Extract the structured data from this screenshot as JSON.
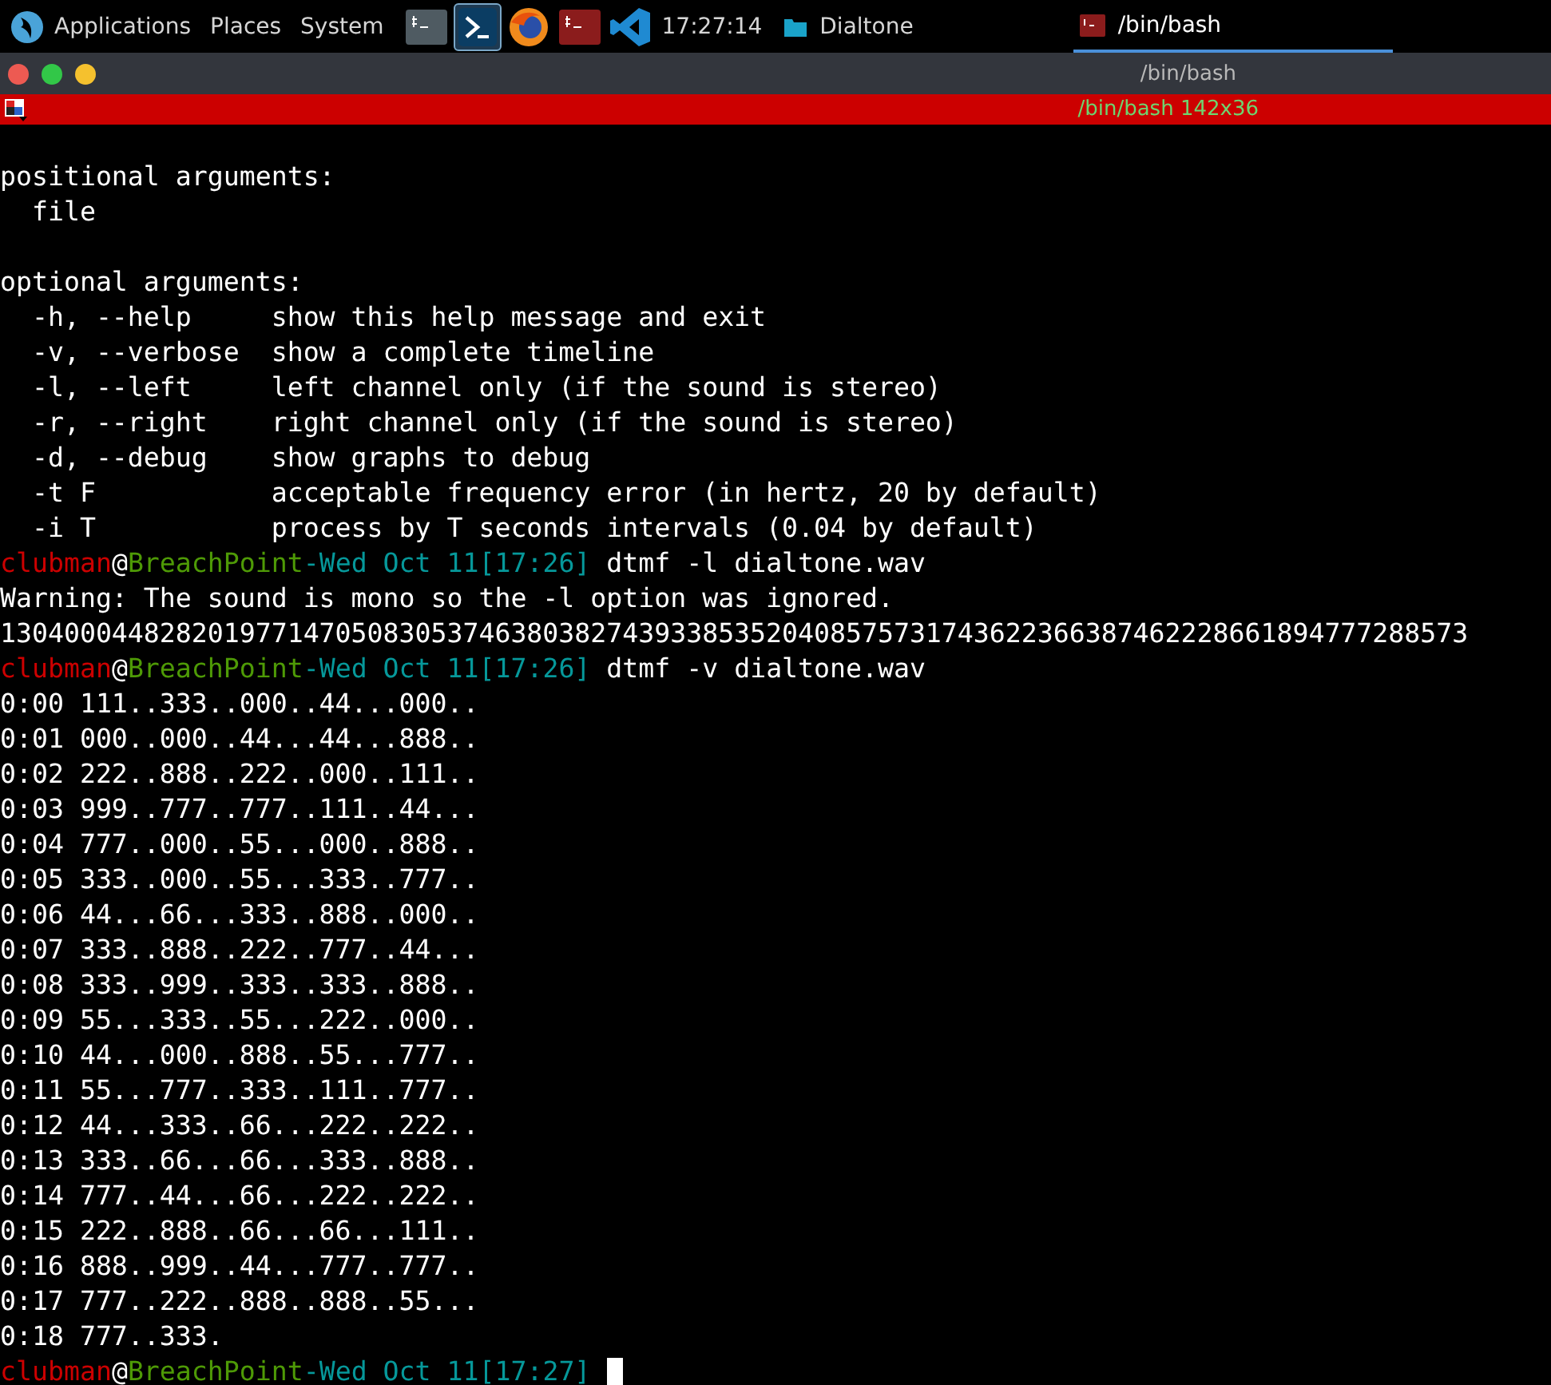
{
  "top_bar": {
    "menus": [
      "Applications",
      "Places",
      "System"
    ],
    "launchers": [
      {
        "kind": "terminal",
        "selected": false
      },
      {
        "kind": "shell",
        "selected": true
      },
      {
        "kind": "browser",
        "selected": false
      },
      {
        "kind": "terminal-red",
        "selected": false
      },
      {
        "kind": "editor",
        "selected": false
      }
    ],
    "clock": "17:27:14",
    "places": [
      {
        "label": "Dialtone"
      }
    ],
    "tasks": [
      {
        "label": "/bin/bash",
        "selected": true
      }
    ]
  },
  "window": {
    "title": "/bin/bash",
    "tab": "/bin/bash 142x36"
  },
  "terminal": {
    "lines": [
      {
        "kind": "blank"
      },
      {
        "kind": "text",
        "text": "positional arguments:"
      },
      {
        "kind": "text",
        "text": "  file"
      },
      {
        "kind": "blank"
      },
      {
        "kind": "text",
        "text": "optional arguments:"
      },
      {
        "kind": "text",
        "text": "  -h, --help     show this help message and exit"
      },
      {
        "kind": "text",
        "text": "  -v, --verbose  show a complete timeline"
      },
      {
        "kind": "text",
        "text": "  -l, --left     left channel only (if the sound is stereo)"
      },
      {
        "kind": "text",
        "text": "  -r, --right    right channel only (if the sound is stereo)"
      },
      {
        "kind": "text",
        "text": "  -d, --debug    show graphs to debug"
      },
      {
        "kind": "text",
        "text": "  -t F           acceptable frequency error (in hertz, 20 by default)"
      },
      {
        "kind": "text",
        "text": "  -i T           process by T seconds intervals (0.04 by default)"
      },
      {
        "kind": "prompt",
        "segments": [
          {
            "text": "clubman",
            "color": "#cc0000"
          },
          {
            "text": "@",
            "color": "#ffffff"
          },
          {
            "text": "BreachPoint",
            "color": "#4e9a06"
          },
          {
            "text": "-Wed Oct 11[17:26]",
            "color": "#06989a"
          },
          {
            "text": " dtmf -l dialtone.wav",
            "color": "#ffffff"
          }
        ]
      },
      {
        "kind": "text",
        "text": "Warning: The sound is mono so the -l option was ignored."
      },
      {
        "kind": "text",
        "text": "13040004482820197714705083053746380382743933853520408575731743622366387462228661894777288573"
      },
      {
        "kind": "prompt",
        "segments": [
          {
            "text": "clubman",
            "color": "#cc0000"
          },
          {
            "text": "@",
            "color": "#ffffff"
          },
          {
            "text": "BreachPoint",
            "color": "#4e9a06"
          },
          {
            "text": "-Wed Oct 11[17:26]",
            "color": "#06989a"
          },
          {
            "text": " dtmf -v dialtone.wav",
            "color": "#ffffff"
          }
        ]
      },
      {
        "kind": "text",
        "text": "0:00 111..333..000..44...000.."
      },
      {
        "kind": "text",
        "text": "0:01 000..000..44...44...888.."
      },
      {
        "kind": "text",
        "text": "0:02 222..888..222..000..111.."
      },
      {
        "kind": "text",
        "text": "0:03 999..777..777..111..44..."
      },
      {
        "kind": "text",
        "text": "0:04 777..000..55...000..888.."
      },
      {
        "kind": "text",
        "text": "0:05 333..000..55...333..777.."
      },
      {
        "kind": "text",
        "text": "0:06 44...66...333..888..000.."
      },
      {
        "kind": "text",
        "text": "0:07 333..888..222..777..44..."
      },
      {
        "kind": "text",
        "text": "0:08 333..999..333..333..888.."
      },
      {
        "kind": "text",
        "text": "0:09 55...333..55...222..000.."
      },
      {
        "kind": "text",
        "text": "0:10 44...000..888..55...777.."
      },
      {
        "kind": "text",
        "text": "0:11 55...777..333..111..777.."
      },
      {
        "kind": "text",
        "text": "0:12 44...333..66...222..222.."
      },
      {
        "kind": "text",
        "text": "0:13 333..66...66...333..888.."
      },
      {
        "kind": "text",
        "text": "0:14 777..44...66...222..222.."
      },
      {
        "kind": "text",
        "text": "0:15 222..888..66...66...111.."
      },
      {
        "kind": "text",
        "text": "0:16 888..999..44...777..777.."
      },
      {
        "kind": "text",
        "text": "0:17 777..222..888..888..55..."
      },
      {
        "kind": "text",
        "text": "0:18 777..333."
      },
      {
        "kind": "prompt",
        "cursor": true,
        "segments": [
          {
            "text": "clubman",
            "color": "#cc0000"
          },
          {
            "text": "@",
            "color": "#ffffff"
          },
          {
            "text": "BreachPoint",
            "color": "#4e9a06"
          },
          {
            "text": "-Wed Oct 11[17:27]",
            "color": "#06989a"
          }
        ]
      }
    ]
  }
}
